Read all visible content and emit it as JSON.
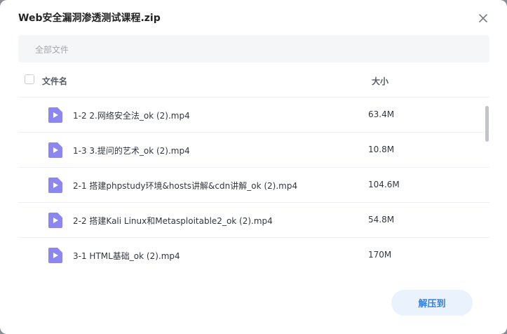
{
  "dialog": {
    "title": "Web安全漏洞渗透测试课程.zip"
  },
  "path_bar": {
    "label": "全部文件"
  },
  "table": {
    "columns": {
      "name": "文件名",
      "size": "大小"
    },
    "rows": [
      {
        "name": "1-2 2.网络安全法_ok (2).mp4",
        "size": "63.4M",
        "icon": "video-file-icon"
      },
      {
        "name": "1-3 3.提问的艺术_ok (2).mp4",
        "size": "10.8M",
        "icon": "video-file-icon"
      },
      {
        "name": "2-1 搭建phpstudy环境&hosts讲解&cdn讲解_ok (2).mp4",
        "size": "104.6M",
        "icon": "video-file-icon"
      },
      {
        "name": "2-2 搭建Kali Linux和Metasploitable2_ok (2).mp4",
        "size": "54.8M",
        "icon": "video-file-icon"
      },
      {
        "name": "3-1 HTML基础_ok (2).mp4",
        "size": "170M",
        "icon": "video-file-icon"
      }
    ]
  },
  "footer": {
    "extract_label": "解压到"
  },
  "colors": {
    "accent": "#2f7fe6",
    "accent_bg": "#eaf3fd",
    "file_icon": "#8b86f0"
  }
}
